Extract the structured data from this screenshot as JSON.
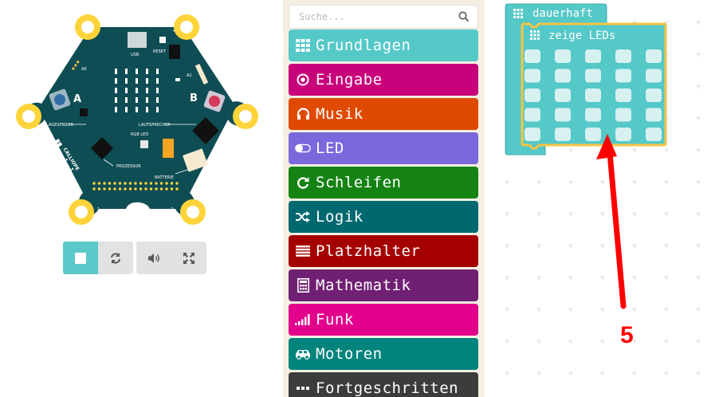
{
  "simulator": {
    "board": {
      "logo_brand": "CALLIOPE",
      "logo_name": "mini",
      "labels": {
        "usb": "USB",
        "reset": "RESET",
        "a0": "A0",
        "a1": "A1",
        "lagesensor": "LAGESENSOR",
        "lautsprecher": "LAUTSPRECHER",
        "rgb_led": "RGB LED",
        "prozessor": "PROZESSOR",
        "batterie": "BATTERIE",
        "minus": "-",
        "plus": "+",
        "pin0": "0",
        "pin1": "1",
        "pin2": "2",
        "pin3": "3"
      },
      "button_a": "A",
      "button_b": "B",
      "colors": {
        "board": "#0f4d54",
        "pad": "#ffd43a",
        "button_a": "#2f6fa6",
        "button_b": "#d53a58",
        "led_off": "#ffffff"
      }
    },
    "controls": {
      "stop": {
        "icon": "stop-icon",
        "color": "#5bc9c9"
      },
      "restart": {
        "icon": "restart-icon"
      },
      "mute": {
        "icon": "speaker-icon"
      },
      "fullscreen": {
        "icon": "fullscreen-icon"
      }
    }
  },
  "toolbox": {
    "search": {
      "placeholder": "Suche...",
      "value": ""
    },
    "categories": [
      {
        "label": "Grundlagen",
        "color": "#55c8c8",
        "icon": "grid-icon"
      },
      {
        "label": "Eingabe",
        "color": "#c8007a",
        "icon": "target-icon"
      },
      {
        "label": "Musik",
        "color": "#e04a00",
        "icon": "headphones-icon"
      },
      {
        "label": "LED",
        "color": "#7b68dd",
        "icon": "toggle-icon"
      },
      {
        "label": "Schleifen",
        "color": "#148314",
        "icon": "loop-icon"
      },
      {
        "label": "Logik",
        "color": "#006970",
        "icon": "shuffle-icon"
      },
      {
        "label": "Platzhalter",
        "color": "#a50000",
        "icon": "lines-icon"
      },
      {
        "label": "Mathematik",
        "color": "#702073",
        "icon": "calculator-icon"
      },
      {
        "label": "Funk",
        "color": "#e3008c",
        "icon": "signal-icon"
      },
      {
        "label": "Motoren",
        "color": "#00847c",
        "icon": "car-icon"
      },
      {
        "label": "Fortgeschritten",
        "color": "#3c3c3c",
        "icon": "dots-icon"
      }
    ]
  },
  "workspace": {
    "forever_block": {
      "label": "dauerhaft",
      "color": "#55c8c8",
      "icon": "grid-icon"
    },
    "show_leds_block": {
      "label": "zeige LEDs",
      "color": "#55c8c8",
      "highlight": "#f5c542",
      "icon": "grid-icon",
      "rows": 5,
      "cols": 5
    },
    "annotation": {
      "text": "5",
      "color": "#ff0000"
    }
  }
}
